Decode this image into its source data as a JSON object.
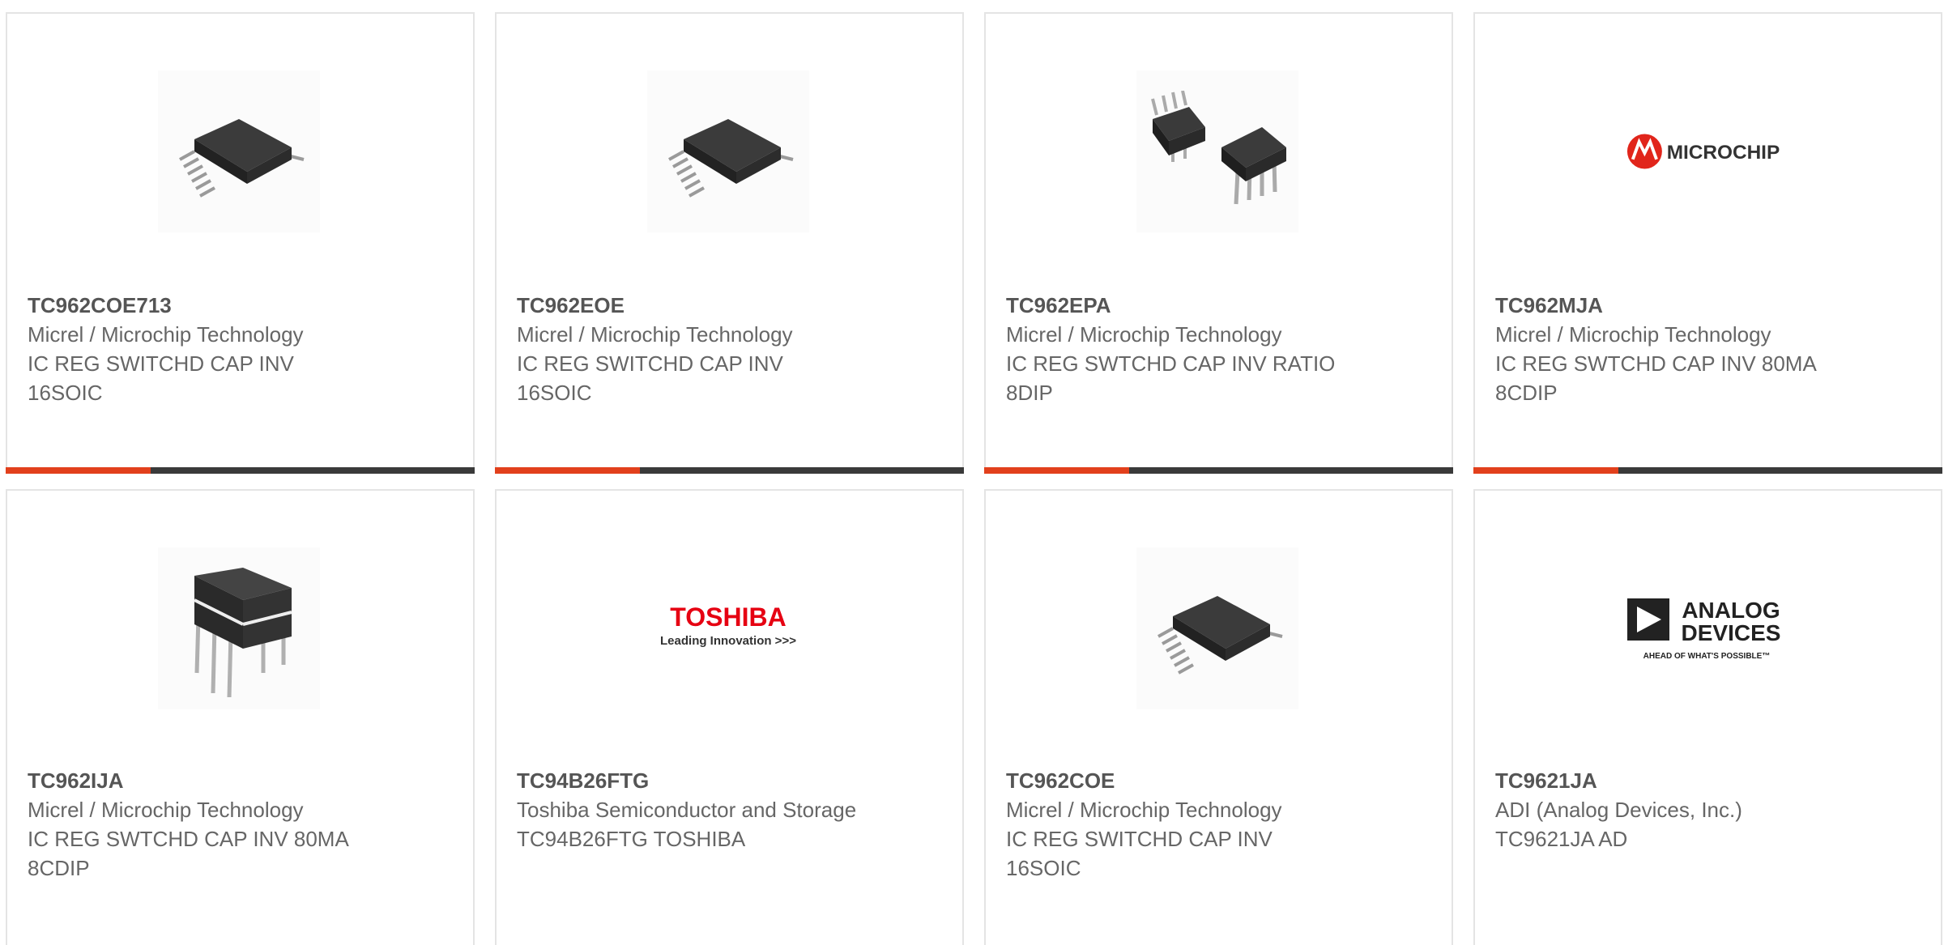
{
  "cards": [
    {
      "part": "TC962COE713",
      "manufacturer": "Micrel / Microchip Technology",
      "description": "IC REG SWITCHD CAP INV 16SOIC",
      "image": "soic-chip-icon"
    },
    {
      "part": "TC962EOE",
      "manufacturer": "Micrel / Microchip Technology",
      "description": "IC REG SWITCHD CAP INV 16SOIC",
      "image": "soic-chip-icon"
    },
    {
      "part": "TC962EPA",
      "manufacturer": "Micrel / Microchip Technology",
      "description": "IC REG SWTCHD CAP INV RATIO 8DIP",
      "image": "dip-chips-icon"
    },
    {
      "part": "TC962MJA",
      "manufacturer": "Micrel / Microchip Technology",
      "description": "IC REG SWTCHD CAP INV 80MA 8CDIP",
      "image": "microchip-logo",
      "logo_text": "MICROCHIP"
    },
    {
      "part": "TC962IJA",
      "manufacturer": "Micrel / Microchip Technology",
      "description": "IC REG SWTCHD CAP INV 80MA 8CDIP",
      "image": "cdip-chip-icon"
    },
    {
      "part": "TC94B26FTG",
      "manufacturer": "Toshiba Semiconductor and Storage",
      "description": "TC94B26FTG TOSHIBA",
      "image": "toshiba-logo",
      "logo_text": "TOSHIBA",
      "logo_tagline": "Leading Innovation >>>"
    },
    {
      "part": "TC962COE",
      "manufacturer": "Micrel / Microchip Technology",
      "description": "IC REG SWITCHD CAP INV 16SOIC",
      "image": "soic-chip-icon"
    },
    {
      "part": "TC9621JA",
      "manufacturer": "ADI (Analog Devices, Inc.)",
      "description": "TC9621JA AD",
      "image": "analog-devices-logo",
      "logo_text_1": "ANALOG",
      "logo_text_2": "DEVICES",
      "logo_tagline": "AHEAD OF WHAT'S POSSIBLE™"
    }
  ],
  "progress_fraction": 0.31,
  "colors": {
    "accent": "#e2401c",
    "bar_dark": "#3a3a3a",
    "toshiba_red": "#e60012",
    "microchip_red": "#e1251b"
  }
}
